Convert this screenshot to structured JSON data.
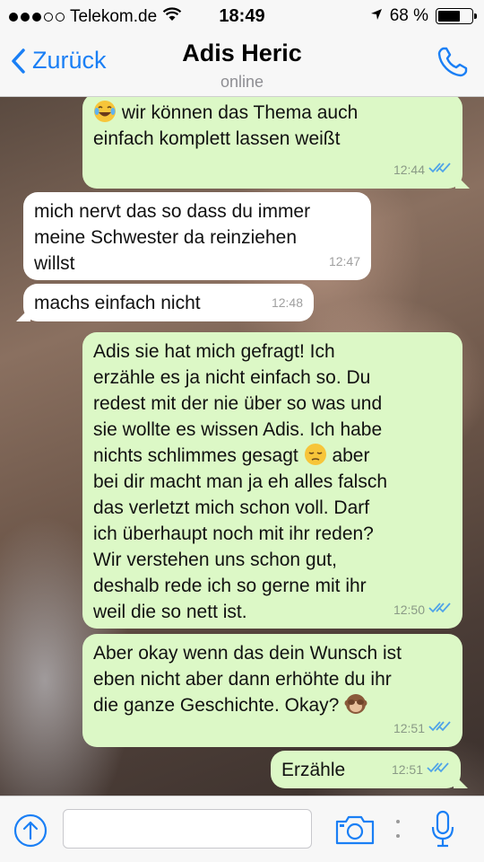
{
  "status_bar": {
    "carrier": "Telekom.de",
    "time": "18:49",
    "battery": "68 %",
    "battery_level": 0.68
  },
  "nav": {
    "back_label": "Zurück",
    "contact_name": "Adis Heric",
    "contact_status": "online"
  },
  "messages": [
    {
      "direction": "out",
      "text": "wir können das Thema auch\neinfach komplett lassen weißt",
      "time": "12:44",
      "read": true,
      "emoji_lead": "joy-emoji"
    },
    {
      "direction": "in",
      "text": "mich nervt das so dass du immer\nmeine Schwester da reinziehen\nwillst",
      "time": "12:47"
    },
    {
      "direction": "in",
      "text": "machs einfach nicht",
      "time": "12:48"
    },
    {
      "direction": "out",
      "text_a": "Adis sie hat mich gefragt! Ich\nerzähle es ja nicht einfach so. Du\nredest mit der nie über so was und\nsie wollte es wissen Adis. Ich habe\nnichts schlimmes gesagt",
      "text_b": "aber\nbei dir macht man ja eh alles falsch\ndas verletzt mich schon voll. Darf\nich überhaupt noch mit ihr reden?\nWir verstehen uns schon gut,\ndeshalb rede ich so gerne mit ihr\nweil die so nett ist.",
      "time": "12:50",
      "read": true,
      "emoji_mid": "pensive-face-emoji"
    },
    {
      "direction": "out",
      "text": "Aber okay wenn das dein Wunsch ist\neben nicht aber dann erhöhte du ihr\ndie ganze Geschichte. Okay?",
      "time": "12:51",
      "read": true,
      "emoji_end": "see-no-evil-monkey-emoji"
    },
    {
      "direction": "out",
      "text": "Erzähle",
      "time": "12:51",
      "read": true
    }
  ],
  "input": {
    "placeholder": ""
  },
  "colors": {
    "accent": "#1a7ff5",
    "outgoing_bubble": "#dcf8c6",
    "incoming_bubble": "#ffffff",
    "read_ticks": "#4fa3e8"
  }
}
